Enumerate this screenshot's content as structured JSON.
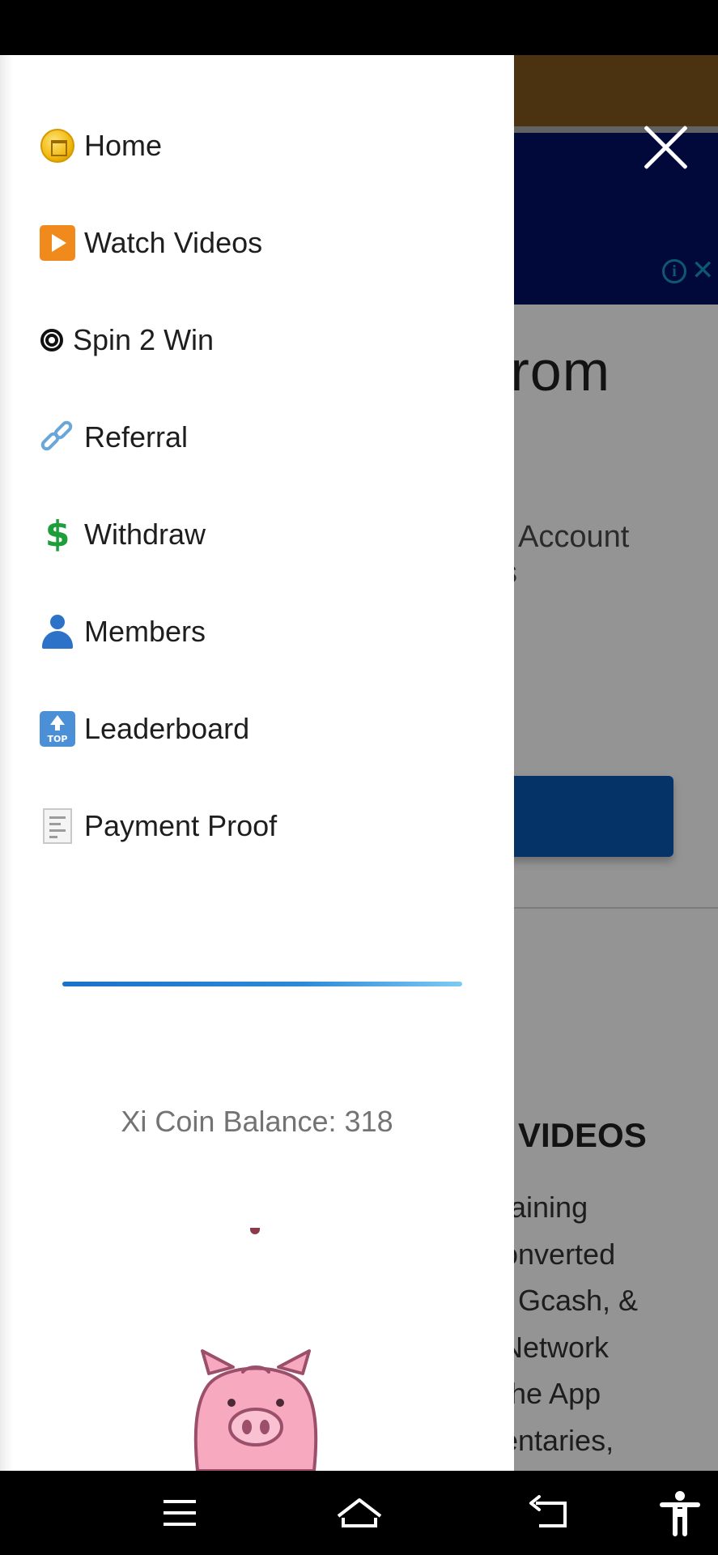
{
  "drawer": {
    "items": [
      {
        "label": "Home",
        "icon": "coin-icon"
      },
      {
        "label": "Watch Videos",
        "icon": "play-button-icon"
      },
      {
        "label": "Spin 2 Win",
        "icon": "radioactive-icon"
      },
      {
        "label": "Referral",
        "icon": "link-icon"
      },
      {
        "label": "Withdraw",
        "icon": "dollar-sign-icon"
      },
      {
        "label": "Members",
        "icon": "person-icon"
      },
      {
        "label": "Leaderboard",
        "icon": "top-arrow-icon"
      },
      {
        "label": "Payment Proof",
        "icon": "receipt-icon"
      }
    ],
    "balance": "Xi Coin Balance: 318",
    "top_icon_text": "TOP"
  },
  "background": {
    "heading_fragment": "from",
    "text_account": "Account",
    "text_s": "s",
    "section_title": "VIDEOS",
    "lines": [
      "taining",
      "onverted",
      ", Gcash, &",
      "Network",
      "the App",
      "entaries,"
    ],
    "ad_info": "i",
    "ad_close": "✕"
  },
  "colors": {
    "header_gold": "#82581f",
    "header_navy": "#001063",
    "accent_blue": "#0a58b4",
    "progress_blue": "#1a72c9"
  }
}
